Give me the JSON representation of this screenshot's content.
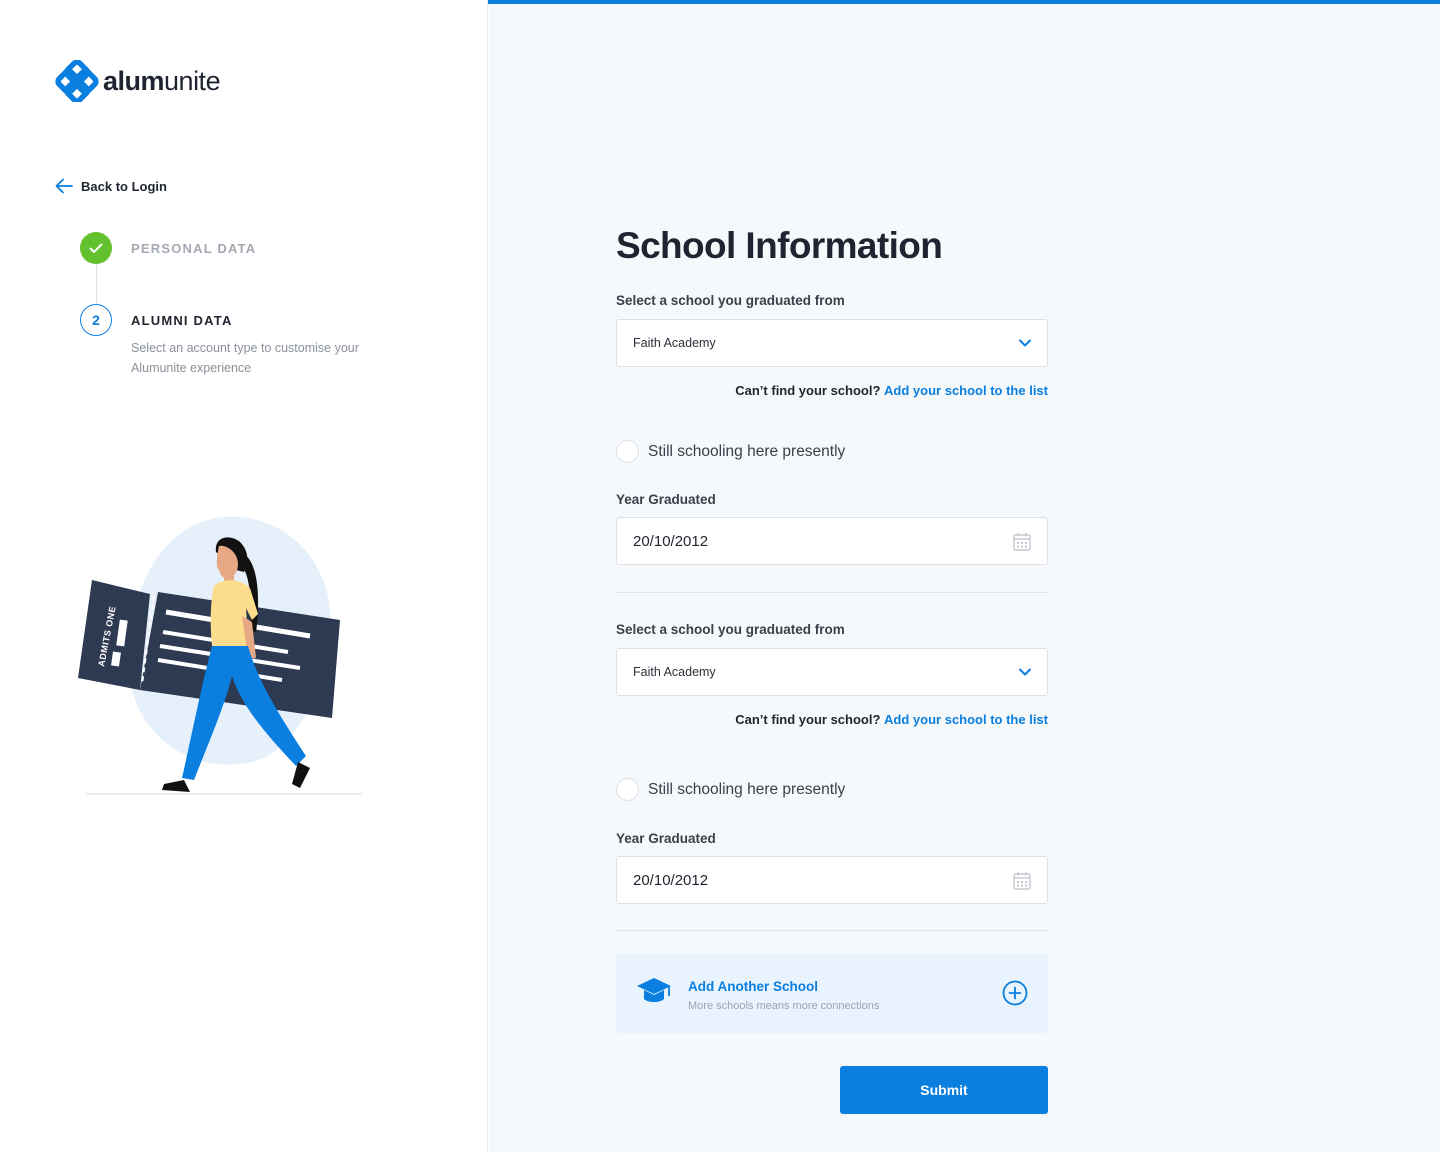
{
  "progress": {
    "fraction": 0.815
  },
  "brand": {
    "name_bold": "alum",
    "name_regular": "unite",
    "color": "#0A7FE0"
  },
  "nav": {
    "back_label": "Back to Login"
  },
  "steps": [
    {
      "number": "1",
      "title": "PERSONAL DATA",
      "status": "complete"
    },
    {
      "number": "2",
      "title": "ALUMNI DATA",
      "status": "current",
      "description": "Select an account type to customise your Alumunite experience"
    }
  ],
  "illustration": {
    "ticket_text": "ADMITS ONE"
  },
  "form": {
    "title": "School Information",
    "schools": [
      {
        "school_label": "Select a school you graduated from",
        "school_value": "Faith Academy",
        "help_question": "Can’t find your school?",
        "help_link": "Add your school to the list",
        "still_schooling_label": "Still schooling here presently",
        "still_schooling_checked": false,
        "year_label": "Year Graduated",
        "year_value": "20/10/2012"
      },
      {
        "school_label": "Select a school you graduated from",
        "school_value": "Faith Academy",
        "help_question": "Can’t find your school?",
        "help_link": "Add your school to the list",
        "still_schooling_label": "Still schooling here presently",
        "still_schooling_checked": false,
        "year_label": "Year Graduated",
        "year_value": "20/10/2012"
      }
    ],
    "add_school": {
      "title": "Add Another School",
      "subtitle": "More schools means more connections"
    },
    "submit_label": "Submit"
  },
  "colors": {
    "accent": "#0A7FE0",
    "success": "#61C12E",
    "navy": "#2E3A52",
    "panel_bg": "#F6F9FC"
  }
}
